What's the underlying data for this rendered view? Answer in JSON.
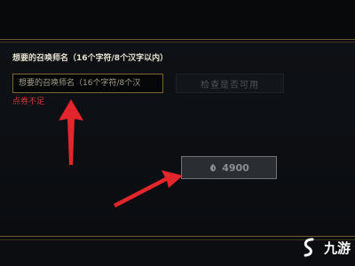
{
  "form": {
    "label": "想要的召唤师名（16个字符/8个汉字以内）",
    "input_placeholder": "想要的召唤师名（16个字符/8个汉",
    "input_value": "",
    "error_text": "点券不足",
    "check_button_label": "检查是否可用"
  },
  "purchase": {
    "currency_icon": "blue-essence-icon",
    "price": "4900"
  },
  "annotations": {
    "arrow_color": "#e3262b"
  },
  "watermark": {
    "text": "九游"
  },
  "colors": {
    "gold_border": "#7a6533",
    "error": "#d03a32",
    "button_disabled_text": "#4f5357"
  }
}
